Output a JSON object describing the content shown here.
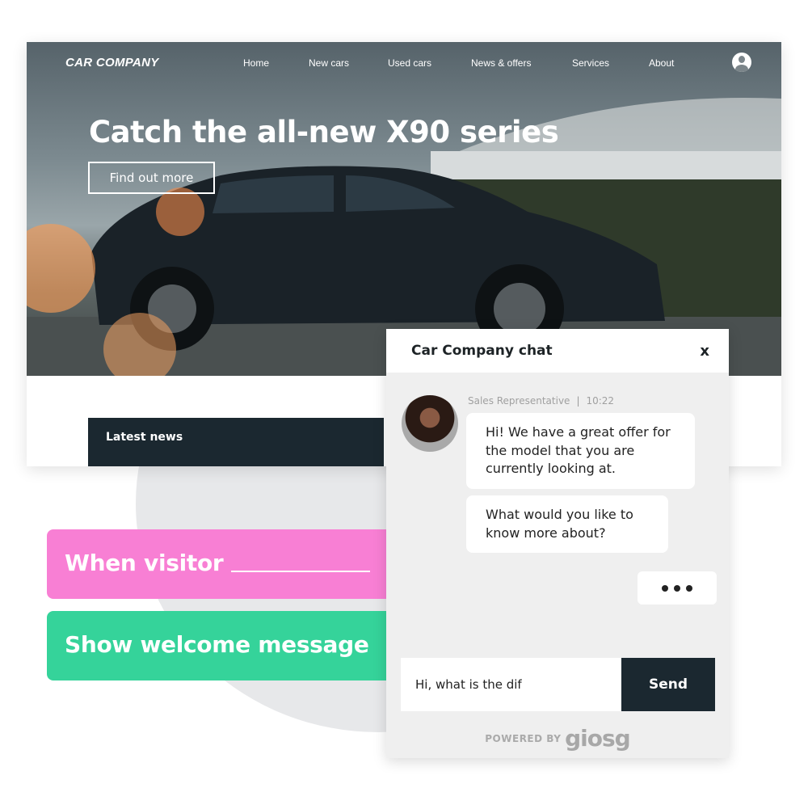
{
  "site": {
    "logo": "CAR COMPANY",
    "nav": [
      "Home",
      "New cars",
      "Used cars",
      "News & offers",
      "Services",
      "About"
    ],
    "headline": "Catch the all-new X90 series",
    "cta": "Find out more",
    "latest_news": "Latest news",
    "user_icon": "user-avatar-icon"
  },
  "rules": {
    "trigger": "When visitor",
    "action": "Show welcome message",
    "colors": {
      "trigger": "#f87fd4",
      "action": "#35d39a"
    }
  },
  "chat": {
    "title": "Car Company chat",
    "close": "x",
    "sender": "Sales Representative",
    "time": "10:22",
    "messages": [
      "Hi! We have a great offer for the model that you are currently looking at.",
      "What would you like to know more about?"
    ],
    "input_value": "Hi, what is the dif",
    "send": "Send",
    "powered_by": "POWERED BY",
    "brand": "giosg",
    "accent": "#1b2830"
  }
}
